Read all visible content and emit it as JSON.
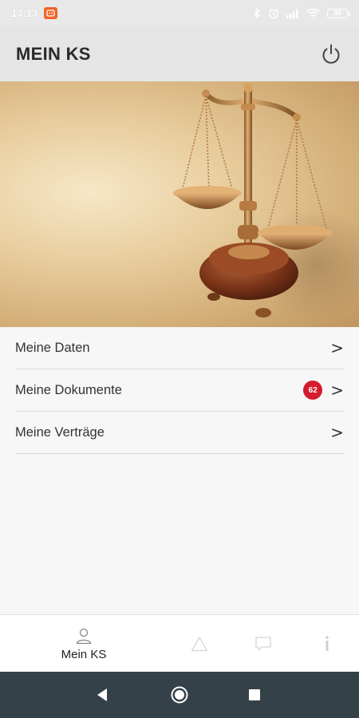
{
  "status_bar": {
    "time": "13:13",
    "battery": "89"
  },
  "app_bar": {
    "title": "MEIN KS",
    "power_icon": "power-icon"
  },
  "hero": {
    "image": "scales-of-justice-image"
  },
  "menu": {
    "items": [
      {
        "label": "Meine Daten",
        "chevron": ">"
      },
      {
        "label": "Meine Dokumente",
        "badge": "62",
        "chevron": ">"
      },
      {
        "label": "Meine Verträge",
        "chevron": ">"
      }
    ]
  },
  "bottom_nav": {
    "items": [
      {
        "label": "Mein KS",
        "icon": "person-icon",
        "active": true
      },
      {
        "label": "",
        "icon": "warning-icon",
        "active": false
      },
      {
        "label": "",
        "icon": "chat-icon",
        "active": false
      },
      {
        "label": "",
        "icon": "info-icon",
        "active": false
      }
    ]
  },
  "colors": {
    "badge": "#d41c2c",
    "app_bar": "#e5e5e5",
    "system_nav": "#354149"
  }
}
